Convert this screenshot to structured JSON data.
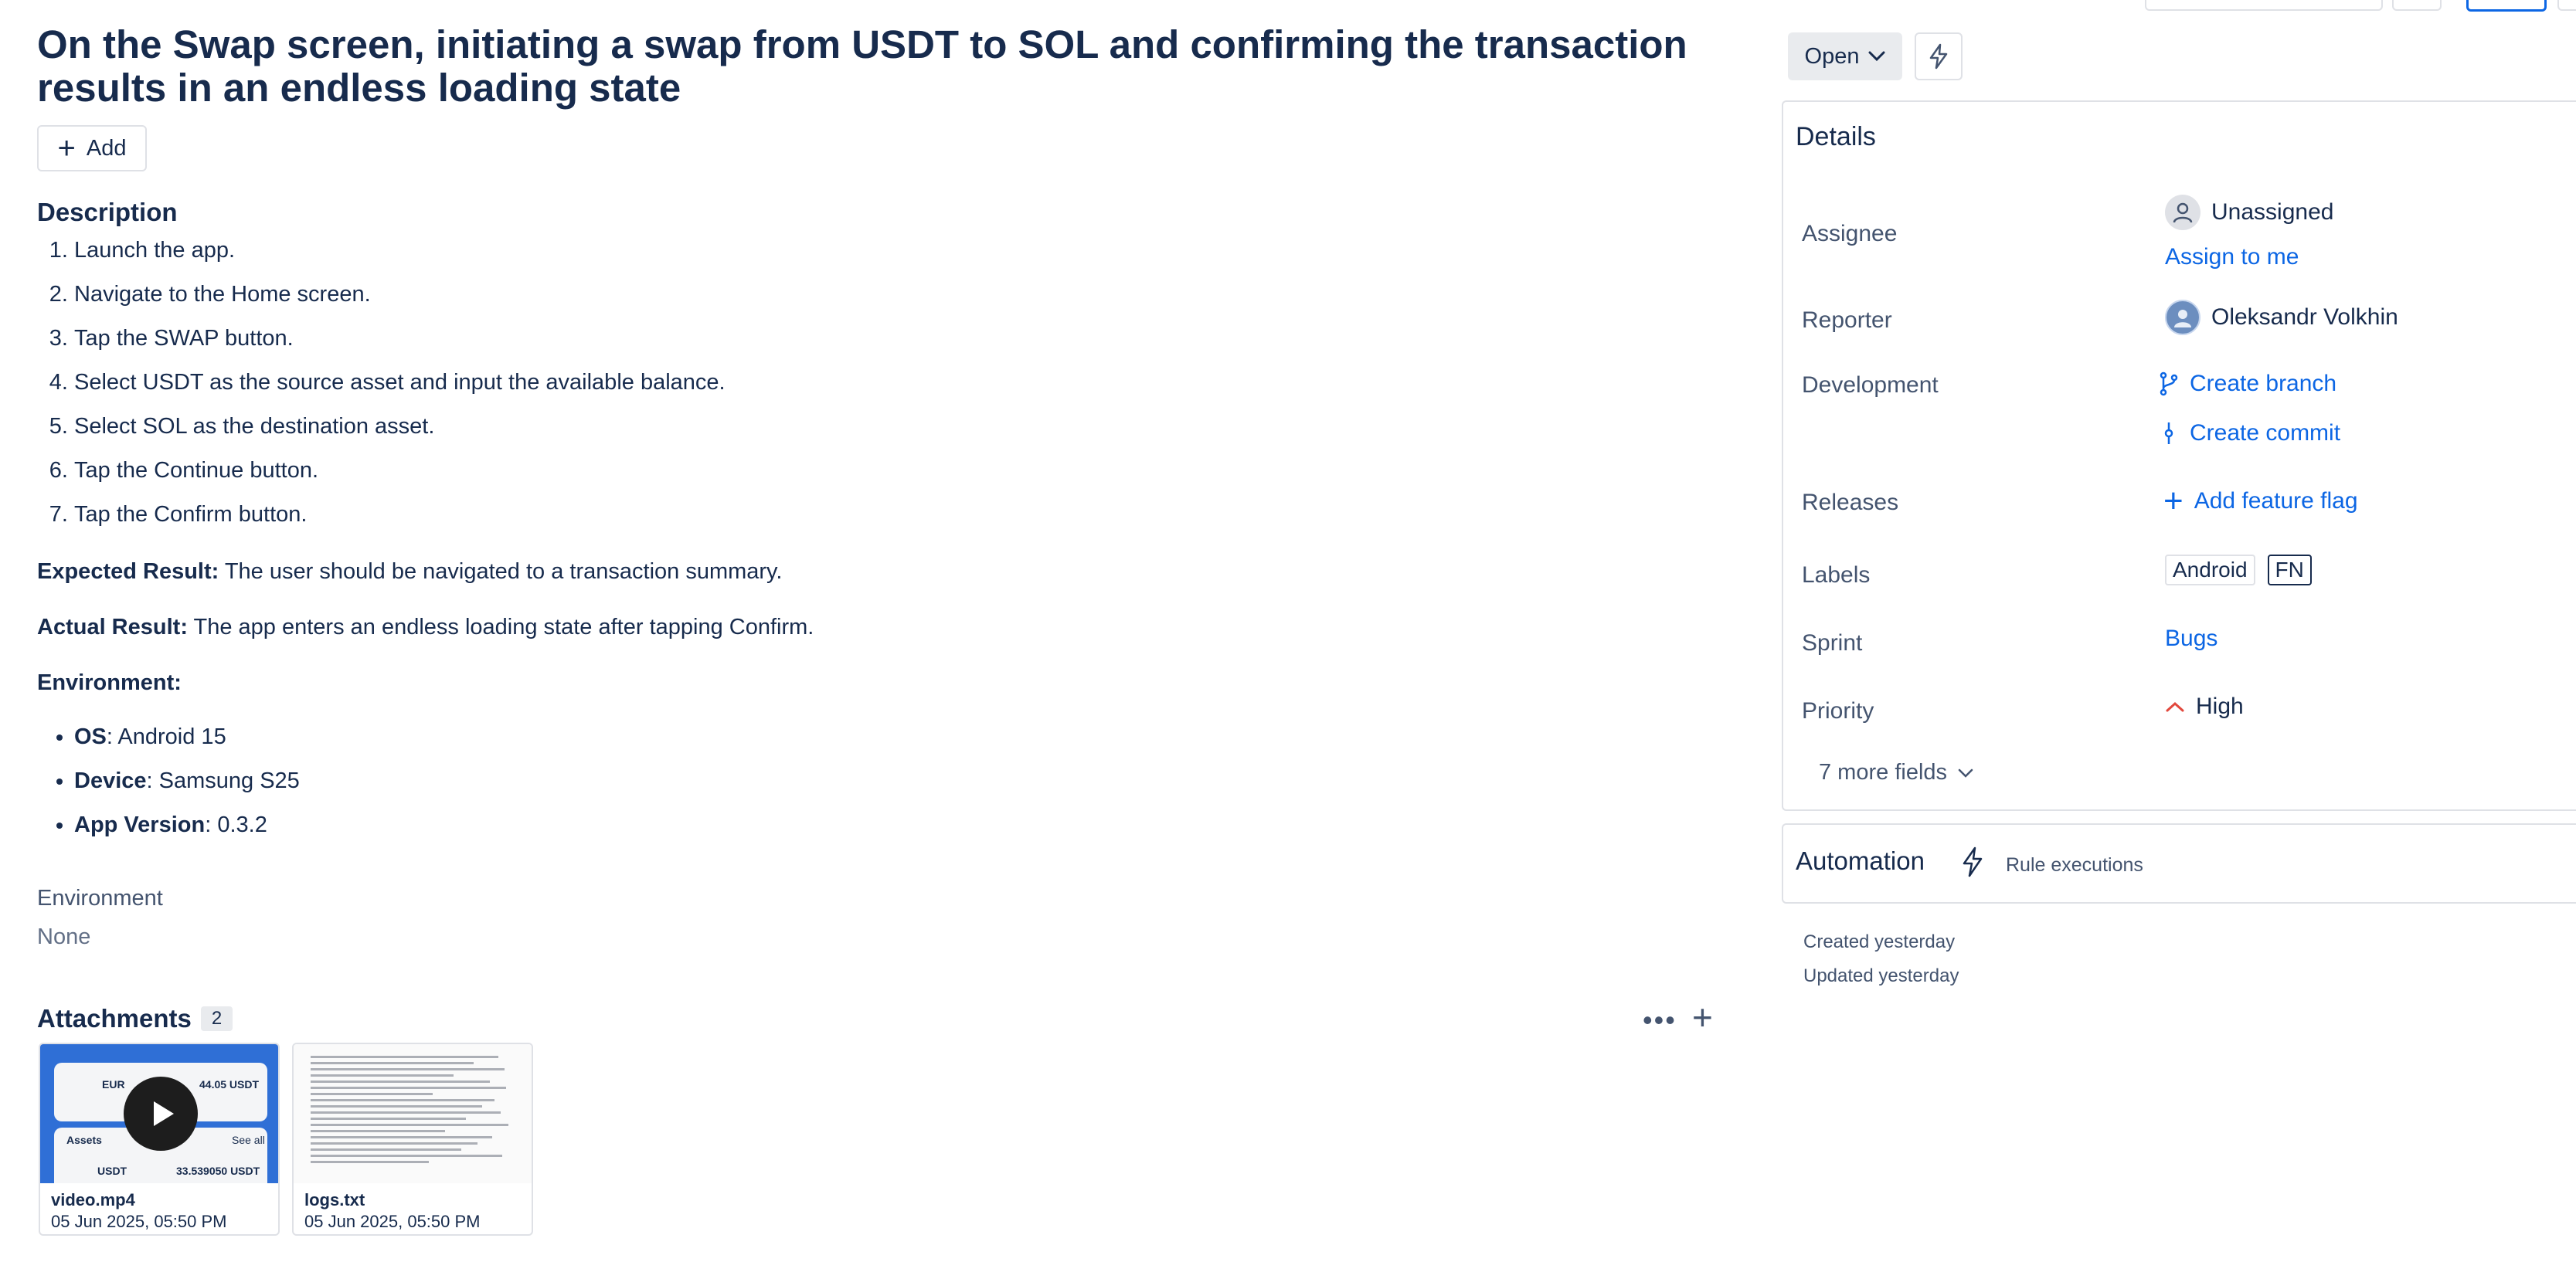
{
  "issue": {
    "title": "On the Swap screen, initiating a swap from USDT to SOL and confirming the transaction results in an endless loading state",
    "add_label": "Add"
  },
  "description": {
    "heading": "Description",
    "steps": [
      "Launch the app.",
      "Navigate to the Home screen.",
      "Tap the SWAP button.",
      "Select USDT as the source asset and input the available balance.",
      "Select SOL as the destination asset.",
      "Tap the Continue button.",
      "Tap the Confirm button."
    ],
    "expected_label": "Expected Result:",
    "expected_text": " The user should be navigated to a transaction summary.",
    "actual_label": "Actual Result:",
    "actual_text": " The app enters an endless loading state after tapping Confirm.",
    "environment_label": "Environment:",
    "env_items": [
      {
        "key": "OS",
        "value": ": Android 15"
      },
      {
        "key": "Device",
        "value": ": Samsung S25"
      },
      {
        "key": "App Version",
        "value": ": 0.3.2"
      }
    ]
  },
  "environment_field": {
    "label": "Environment",
    "value": "None"
  },
  "attachments": {
    "heading": "Attachments",
    "count": "2",
    "items": [
      {
        "name": "video.mp4",
        "date": "05 Jun 2025, 05:50 PM",
        "thumb_text": {
          "currency": "EUR",
          "balance": "44.05 USDT",
          "assets": "Assets",
          "see_all": "See all",
          "asset": "USDT",
          "asset_balance": "33.539050 USDT"
        }
      },
      {
        "name": "logs.txt",
        "date": "05 Jun 2025, 05:50 PM"
      }
    ]
  },
  "sidebar": {
    "status": "Open",
    "details_heading": "Details",
    "fields": {
      "assignee_label": "Assignee",
      "assignee_value": "Unassigned",
      "assign_to_me": "Assign to me",
      "reporter_label": "Reporter",
      "reporter_value": "Oleksandr Volkhin",
      "development_label": "Development",
      "create_branch": "Create branch",
      "create_commit": "Create commit",
      "releases_label": "Releases",
      "add_feature_flag": "Add feature flag",
      "labels_label": "Labels",
      "labels": [
        "Android",
        "FN"
      ],
      "sprint_label": "Sprint",
      "sprint_value": "Bugs",
      "priority_label": "Priority",
      "priority_value": "High"
    },
    "more_fields": "7 more fields",
    "automation_heading": "Automation",
    "rule_executions": "Rule executions",
    "created": "Created yesterday",
    "updated": "Updated yesterday"
  },
  "colors": {
    "link": "#0c66e4",
    "text": "#172b4d",
    "subtle": "#44546f",
    "priority_high": "#e2483d"
  }
}
